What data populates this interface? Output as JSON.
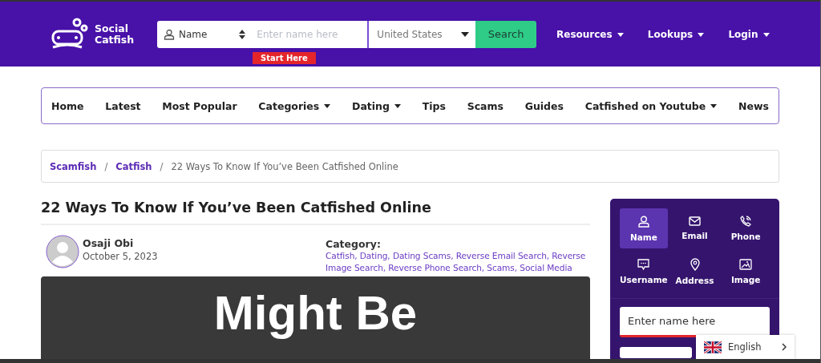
{
  "header": {
    "logo": [
      "Social",
      "Catfish"
    ],
    "search": {
      "type_label": "Name",
      "placeholder": "Enter name here",
      "country": "United States",
      "button": "Search",
      "hint": "Start Here"
    },
    "menu": [
      {
        "label": "Resources"
      },
      {
        "label": "Lookups"
      },
      {
        "label": "Login"
      }
    ]
  },
  "nav": [
    {
      "label": "Home",
      "dropdown": false
    },
    {
      "label": "Latest",
      "dropdown": false
    },
    {
      "label": "Most Popular",
      "dropdown": false
    },
    {
      "label": "Categories",
      "dropdown": true
    },
    {
      "label": "Dating",
      "dropdown": true
    },
    {
      "label": "Tips",
      "dropdown": false
    },
    {
      "label": "Scams",
      "dropdown": false
    },
    {
      "label": "Guides",
      "dropdown": false
    },
    {
      "label": "Catfished on Youtube",
      "dropdown": true
    },
    {
      "label": "News",
      "dropdown": false
    }
  ],
  "breadcrumb_separator": "/",
  "breadcrumb": [
    {
      "label": "Scamfish",
      "link": true
    },
    {
      "label": "Catfish",
      "link": true
    },
    {
      "label": "22 Ways To Know If You’ve Been Catfished Online",
      "link": false
    }
  ],
  "article": {
    "title": "22 Ways To Know If You’ve Been Catfished Online",
    "author": "Osaji Obi",
    "date": "October 5, 2023",
    "category_label": "Category:",
    "categories": "Catfish, Dating, Dating Scams, Reverse Email Search, Reverse Image Search, Reverse Phone Search, Scams, Social Media",
    "banner_text": "Might Be"
  },
  "sidebar": {
    "tabs": [
      {
        "kind": "person",
        "label": "Name",
        "selected": true
      },
      {
        "kind": "mail",
        "label": "Email",
        "selected": false
      },
      {
        "kind": "phone",
        "label": "Phone",
        "selected": false
      },
      {
        "kind": "chat",
        "label": "Username",
        "selected": false
      },
      {
        "kind": "pin",
        "label": "Address",
        "selected": false
      },
      {
        "kind": "image",
        "label": "Image",
        "selected": false
      }
    ],
    "placeholder": "Enter name here"
  },
  "language": {
    "label": "English"
  }
}
